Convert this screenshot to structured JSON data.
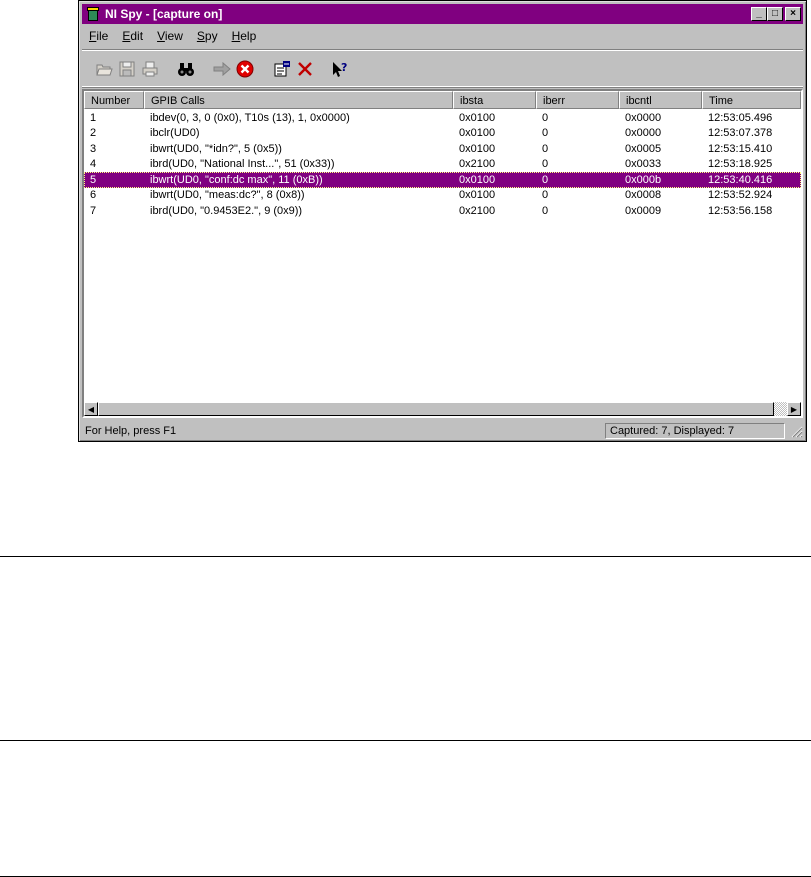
{
  "window": {
    "title": "NI Spy - [capture on]",
    "controls": {
      "minimize": "_",
      "maximize": "□",
      "close": "×"
    }
  },
  "menu": [
    {
      "label": "File",
      "key": "F",
      "rest": "ile"
    },
    {
      "label": "Edit",
      "key": "E",
      "rest": "dit"
    },
    {
      "label": "View",
      "key": "V",
      "rest": "iew"
    },
    {
      "label": "Spy",
      "key": "S",
      "rest": "py"
    },
    {
      "label": "Help",
      "key": "H",
      "rest": "elp"
    }
  ],
  "toolbar": [
    {
      "name": "open-icon",
      "enabled": false
    },
    {
      "name": "save-icon",
      "enabled": false
    },
    {
      "name": "print-icon",
      "enabled": false
    },
    {
      "name": "find-icon",
      "enabled": true
    },
    {
      "name": "start-capture-icon",
      "enabled": false
    },
    {
      "name": "stop-capture-icon",
      "enabled": true
    },
    {
      "name": "properties-icon",
      "enabled": true
    },
    {
      "name": "clear-icon",
      "enabled": true
    },
    {
      "name": "context-help-icon",
      "enabled": true
    }
  ],
  "table": {
    "columns": [
      "Number",
      "GPIB Calls",
      "ibsta",
      "iberr",
      "ibcntl",
      "Time"
    ],
    "rows": [
      [
        "1",
        "ibdev(0, 3, 0 (0x0), T10s (13), 1, 0x0000)",
        "0x0100",
        "0",
        "0x0000",
        "12:53:05.496"
      ],
      [
        "2",
        "ibclr(UD0)",
        "0x0100",
        "0",
        "0x0000",
        "12:53:07.378"
      ],
      [
        "3",
        "ibwrt(UD0, \"*idn?\", 5 (0x5))",
        "0x0100",
        "0",
        "0x0005",
        "12:53:15.410"
      ],
      [
        "4",
        "ibrd(UD0, \"National Inst...\", 51 (0x33))",
        "0x2100",
        "0",
        "0x0033",
        "12:53:18.925"
      ],
      [
        "5",
        "ibwrt(UD0, \"conf:dc max\", 11 (0xB))",
        "0x0100",
        "0",
        "0x000b",
        "12:53:40.416"
      ],
      [
        "6",
        "ibwrt(UD0, \"meas:dc?\", 8 (0x8))",
        "0x0100",
        "0",
        "0x0008",
        "12:53:52.924"
      ],
      [
        "7",
        "ibrd(UD0, \"0.9453E2.\", 9 (0x9))",
        "0x2100",
        "0",
        "0x0009",
        "12:53:56.158"
      ]
    ],
    "selected_row": 4
  },
  "status": {
    "help": "For Help, press F1",
    "counts": "Captured: 7, Displayed: 7"
  },
  "colors": {
    "accent": "#800080",
    "face": "#c0c0c0"
  }
}
